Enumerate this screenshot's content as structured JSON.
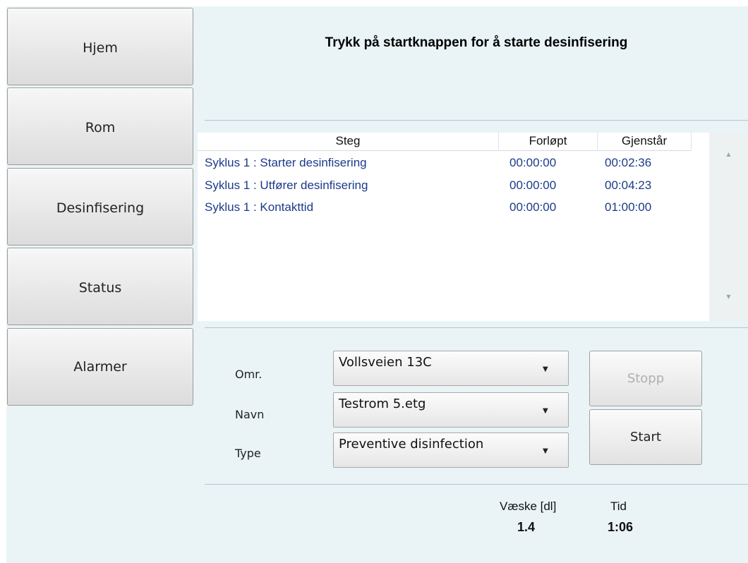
{
  "nav": {
    "items": [
      {
        "label": "Hjem"
      },
      {
        "label": "Rom"
      },
      {
        "label": "Desinfisering"
      },
      {
        "label": "Status"
      },
      {
        "label": "Alarmer"
      }
    ]
  },
  "main": {
    "title": "Trykk på startknappen for å starte desinfisering"
  },
  "table": {
    "headers": [
      "Steg",
      "Forløpt",
      "Gjenstår"
    ],
    "rows": [
      {
        "step": "Syklus 1 : Starter desinfisering",
        "elapsed": "00:00:00",
        "remaining": "00:02:36"
      },
      {
        "step": "Syklus 1 : Utfører desinfisering",
        "elapsed": "00:00:00",
        "remaining": "00:04:23"
      },
      {
        "step": "Syklus 1 : Kontakttid",
        "elapsed": "00:00:00",
        "remaining": "01:00:00"
      }
    ]
  },
  "form": {
    "area_label": "Omr.",
    "area_value": "Vollsveien 13C",
    "name_label": "Navn",
    "name_value": "Testrom 5.etg",
    "type_label": "Type",
    "type_value": "Preventive disinfection"
  },
  "actions": {
    "stop_label": "Stopp",
    "start_label": "Start"
  },
  "stats": {
    "liquid_label": "Væske [dl]",
    "liquid_value": "1.4",
    "time_label": "Tid",
    "time_value": "1:06"
  },
  "colors": {
    "panel_bg": "#eaf4f7",
    "row_text": "#1b3a8a",
    "disabled_text": "#b0b0b0"
  }
}
